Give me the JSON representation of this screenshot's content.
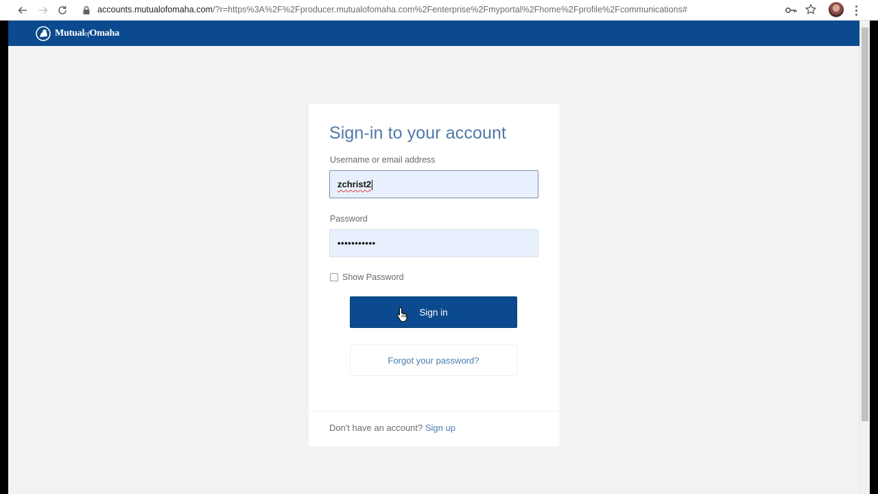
{
  "browser": {
    "url_host": "accounts.mutualofomaha.com",
    "url_rest": "/?r=https%3A%2F%2Fproducer.mutualofomaha.com%2Fenterprise%2Fmyportal%2Fhome%2Fprofile%2Fcommunications#"
  },
  "header": {
    "logo_main": "Mutual",
    "logo_of": "of",
    "logo_end": "Omaha"
  },
  "card": {
    "title": "Sign-in to your account",
    "username_label": "Username or email address",
    "username_value": "zchrist2",
    "password_label": "Password",
    "password_masked": "•••••••••••",
    "show_password_label": "Show Password",
    "signin_label": "Sign in",
    "forgot_label": "Forgot your password?",
    "signup_prompt": "Don't have an account?",
    "signup_link": "Sign up"
  },
  "colors": {
    "brand_blue": "#0b4a8e",
    "link_blue": "#4a7cb1",
    "title_blue": "#4f79a6",
    "autofill_bg": "#e8f0fe"
  }
}
